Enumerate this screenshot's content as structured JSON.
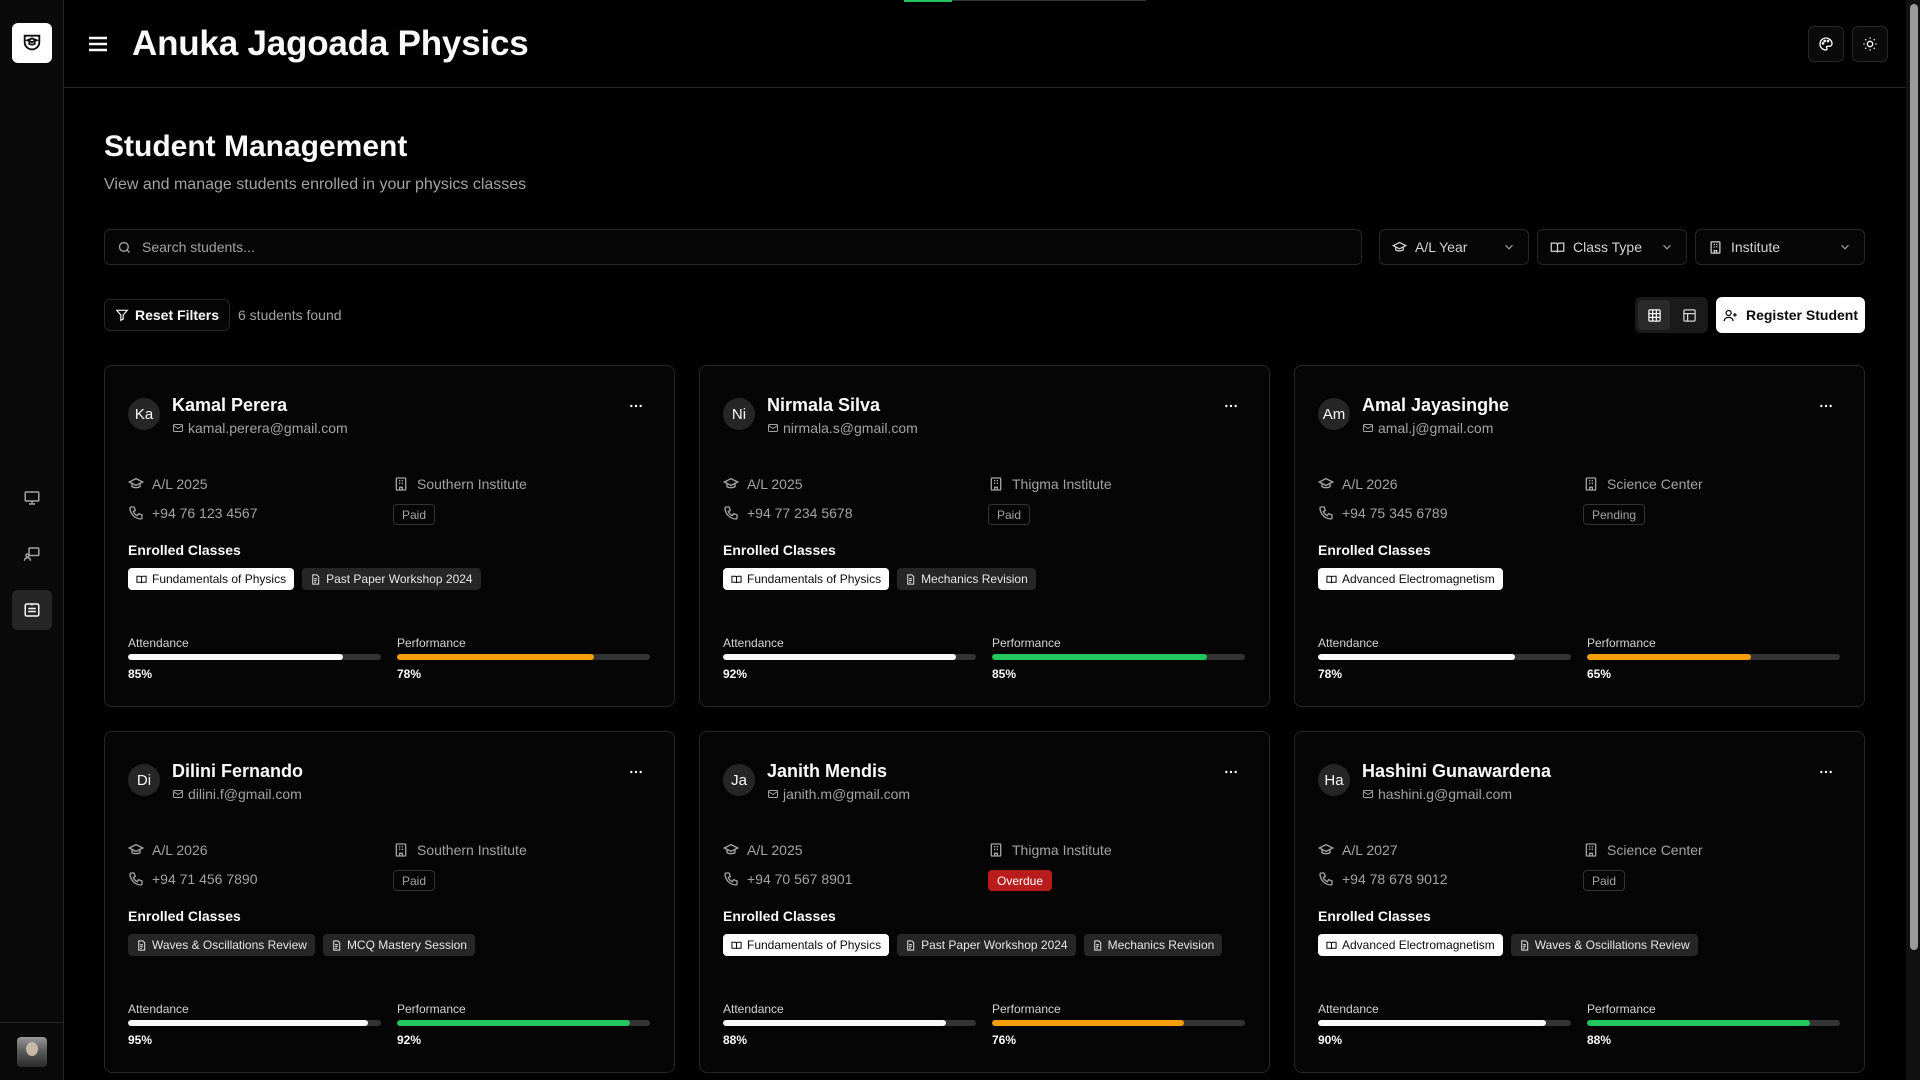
{
  "app": {
    "title": "Anuka Jagoada Physics"
  },
  "page": {
    "title": "Student Management",
    "subtitle": "View and manage students enrolled in your physics classes"
  },
  "search": {
    "placeholder": "Search students..."
  },
  "filters": {
    "al_year": "A/L Year",
    "class_type": "Class Type",
    "institute": "Institute"
  },
  "toolbar": {
    "reset_label": "Reset Filters",
    "count_text": "6 students found",
    "register_label": "Register Student"
  },
  "sidebar": {
    "items": [
      "monitor-icon",
      "presentation-icon",
      "students-icon"
    ],
    "active": 2
  },
  "colors": {
    "accent_green": "#22c55e",
    "accent_orange": "#f59e0b",
    "overdue_red": "#b91c1c"
  },
  "students": [
    {
      "initials": "Ka",
      "name": "Kamal Perera",
      "email": "kamal.perera@gmail.com",
      "year": "A/L 2025",
      "institute": "Southern Institute",
      "phone": "+94 76 123 4567",
      "status": "Paid",
      "enrolled_label": "Enrolled Classes",
      "classes": [
        {
          "label": "Fundamentals of Physics",
          "style": "primary",
          "icon": "book-icon"
        },
        {
          "label": "Past Paper Workshop 2024",
          "style": "secondary",
          "icon": "document-icon"
        }
      ],
      "attendance_label": "Attendance",
      "attendance": 85,
      "attendance_text": "85%",
      "performance_label": "Performance",
      "performance": 78,
      "performance_text": "78%",
      "performance_color": "#f59e0b"
    },
    {
      "initials": "Ni",
      "name": "Nirmala Silva",
      "email": "nirmala.s@gmail.com",
      "year": "A/L 2025",
      "institute": "Thigma Institute",
      "phone": "+94 77 234 5678",
      "status": "Paid",
      "enrolled_label": "Enrolled Classes",
      "classes": [
        {
          "label": "Fundamentals of Physics",
          "style": "primary",
          "icon": "book-icon"
        },
        {
          "label": "Mechanics Revision",
          "style": "secondary",
          "icon": "document-icon"
        }
      ],
      "attendance_label": "Attendance",
      "attendance": 92,
      "attendance_text": "92%",
      "performance_label": "Performance",
      "performance": 85,
      "performance_text": "85%",
      "performance_color": "#22c55e"
    },
    {
      "initials": "Am",
      "name": "Amal Jayasinghe",
      "email": "amal.j@gmail.com",
      "year": "A/L 2026",
      "institute": "Science Center",
      "phone": "+94 75 345 6789",
      "status": "Pending",
      "enrolled_label": "Enrolled Classes",
      "classes": [
        {
          "label": "Advanced Electromagnetism",
          "style": "primary",
          "icon": "book-icon"
        }
      ],
      "attendance_label": "Attendance",
      "attendance": 78,
      "attendance_text": "78%",
      "performance_label": "Performance",
      "performance": 65,
      "performance_text": "65%",
      "performance_color": "#f59e0b"
    },
    {
      "initials": "Di",
      "name": "Dilini Fernando",
      "email": "dilini.f@gmail.com",
      "year": "A/L 2026",
      "institute": "Southern Institute",
      "phone": "+94 71 456 7890",
      "status": "Paid",
      "enrolled_label": "Enrolled Classes",
      "classes": [
        {
          "label": "Waves & Oscillations Review",
          "style": "secondary",
          "icon": "document-icon"
        },
        {
          "label": "MCQ Mastery Session",
          "style": "secondary",
          "icon": "document-icon"
        }
      ],
      "attendance_label": "Attendance",
      "attendance": 95,
      "attendance_text": "95%",
      "performance_label": "Performance",
      "performance": 92,
      "performance_text": "92%",
      "performance_color": "#22c55e"
    },
    {
      "initials": "Ja",
      "name": "Janith Mendis",
      "email": "janith.m@gmail.com",
      "year": "A/L 2025",
      "institute": "Thigma Institute",
      "phone": "+94 70 567 8901",
      "status": "Overdue",
      "enrolled_label": "Enrolled Classes",
      "classes": [
        {
          "label": "Fundamentals of Physics",
          "style": "primary",
          "icon": "book-icon"
        },
        {
          "label": "Past Paper Workshop 2024",
          "style": "secondary",
          "icon": "document-icon"
        },
        {
          "label": "Mechanics Revision",
          "style": "secondary",
          "icon": "document-icon"
        }
      ],
      "attendance_label": "Attendance",
      "attendance": 88,
      "attendance_text": "88%",
      "performance_label": "Performance",
      "performance": 76,
      "performance_text": "76%",
      "performance_color": "#f59e0b"
    },
    {
      "initials": "Ha",
      "name": "Hashini Gunawardena",
      "email": "hashini.g@gmail.com",
      "year": "A/L 2027",
      "institute": "Science Center",
      "phone": "+94 78 678 9012",
      "status": "Paid",
      "enrolled_label": "Enrolled Classes",
      "classes": [
        {
          "label": "Advanced Electromagnetism",
          "style": "primary",
          "icon": "book-icon"
        },
        {
          "label": "Waves & Oscillations Review",
          "style": "secondary",
          "icon": "document-icon"
        }
      ],
      "attendance_label": "Attendance",
      "attendance": 90,
      "attendance_text": "90%",
      "performance_label": "Performance",
      "performance": 88,
      "performance_text": "88%",
      "performance_color": "#22c55e"
    }
  ]
}
